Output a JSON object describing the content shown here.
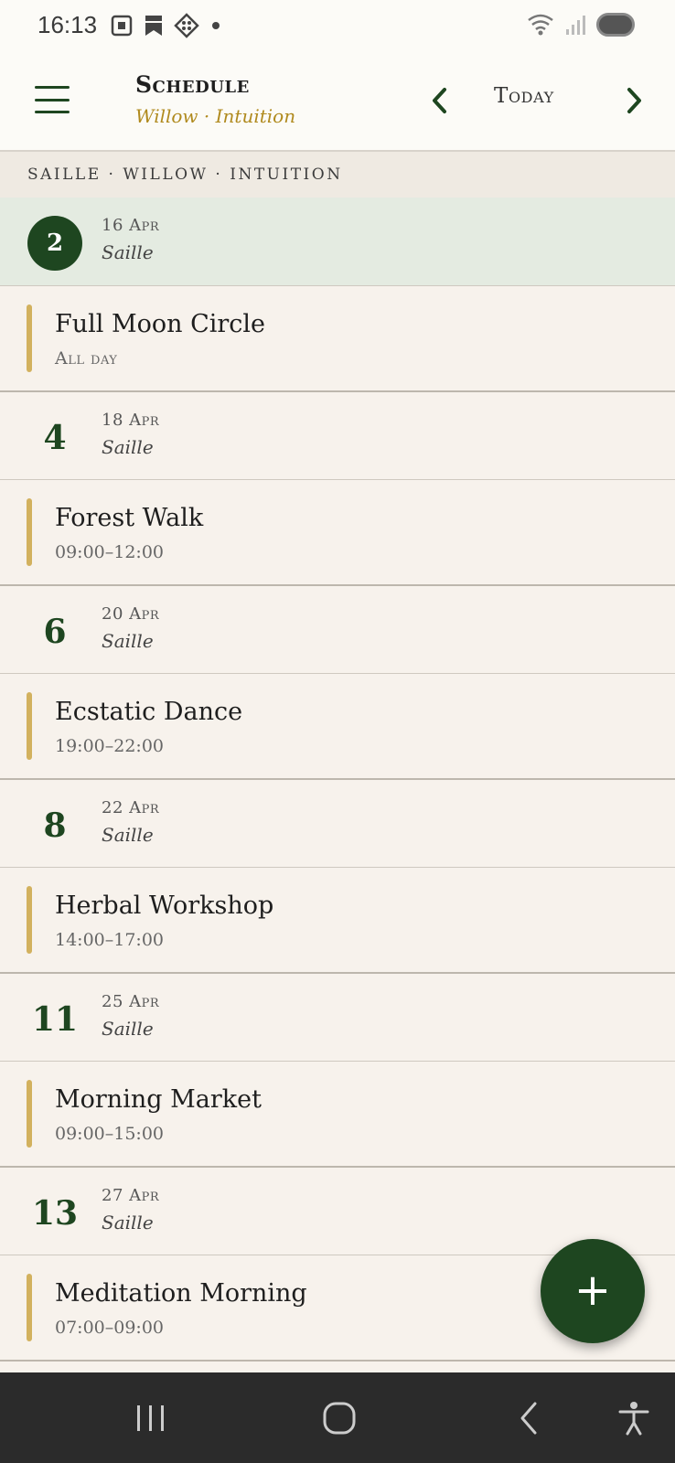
{
  "status_bar": {
    "time": "16:13",
    "icons_left": [
      "screenshot-icon",
      "bookmark-icon",
      "app-icon",
      "dot-icon"
    ],
    "icons_right": [
      "wifi-icon",
      "signal-icon",
      "battery-icon"
    ]
  },
  "app_bar": {
    "title": "Schedule",
    "subtitle": "Willow · Intuition",
    "today_label": "Today"
  },
  "section_header": "Saille · Willow · Intuition",
  "days": [
    {
      "number": "2",
      "date": "16 Apr",
      "name": "Saille",
      "selected": true,
      "event": {
        "title": "Full Moon Circle",
        "time": "All day"
      }
    },
    {
      "number": "4",
      "date": "18 Apr",
      "name": "Saille",
      "selected": false,
      "event": {
        "title": "Forest Walk",
        "time": "09:00–12:00"
      }
    },
    {
      "number": "6",
      "date": "20 Apr",
      "name": "Saille",
      "selected": false,
      "event": {
        "title": "Ecstatic Dance",
        "time": "19:00–22:00"
      }
    },
    {
      "number": "8",
      "date": "22 Apr",
      "name": "Saille",
      "selected": false,
      "event": {
        "title": "Herbal Workshop",
        "time": "14:00–17:00"
      }
    },
    {
      "number": "11",
      "date": "25 Apr",
      "name": "Saille",
      "selected": false,
      "event": {
        "title": "Morning Market",
        "time": "09:00–15:00"
      }
    },
    {
      "number": "13",
      "date": "27 Apr",
      "name": "Saille",
      "selected": false,
      "event": {
        "title": "Meditation Morning",
        "time": "07:00–09:00"
      }
    }
  ],
  "fab": {
    "label": "+"
  },
  "colors": {
    "accent": "#1e4620",
    "gold": "#b08a1e",
    "event_bar": "#d2b15e",
    "selected_row": "#e4ebe1",
    "background": "#f7f2ec"
  }
}
